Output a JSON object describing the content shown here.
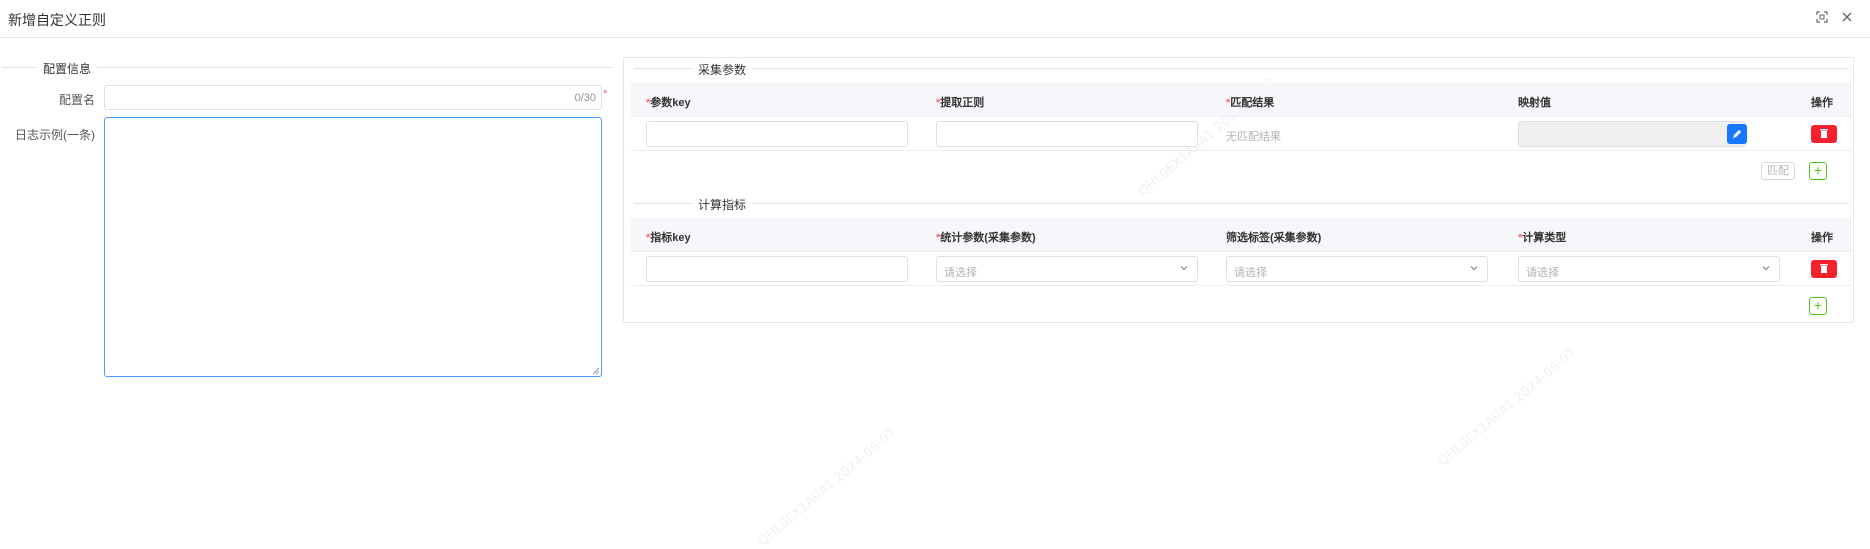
{
  "dialog": {
    "title": "新增自定义正则"
  },
  "config_section": {
    "legend": "配置信息",
    "name_label": "配置名",
    "name_value": "",
    "name_counter": "0/30",
    "required_mark": "*",
    "log_sample_label": "日志示例(一条)",
    "log_sample_value": ""
  },
  "collect_section": {
    "legend": "采集参数",
    "columns": {
      "param_key": "参数key",
      "extract_regex": "提取正则",
      "match_result": "匹配结果",
      "mapped_value": "映射值",
      "action": "操作"
    },
    "row": {
      "param_key_value": "",
      "extract_regex_value": "",
      "match_result_text": "无匹配结果",
      "mapped_value": ""
    },
    "match_button": "匹配",
    "add_button": "+"
  },
  "metric_section": {
    "legend": "计算指标",
    "columns": {
      "metric_key": "指标key",
      "stat_param": "统计参数(采集参数)",
      "filter_tag": "筛选标签(采集参数)",
      "calc_type": "计算类型",
      "action": "操作"
    },
    "row": {
      "metric_key_value": "",
      "select_placeholder": "请选择"
    },
    "add_button": "+"
  },
  "watermark_text": "QHL0EX1A0A1 2024-06-07",
  "colors": {
    "danger": "#f5222d",
    "primary": "#1677ff",
    "success": "#52c41a",
    "required": "#f56c6c"
  },
  "icons": [
    "maximize-icon",
    "close-icon",
    "edit-icon",
    "trash-icon",
    "chevron-down-icon",
    "plus-icon"
  ]
}
